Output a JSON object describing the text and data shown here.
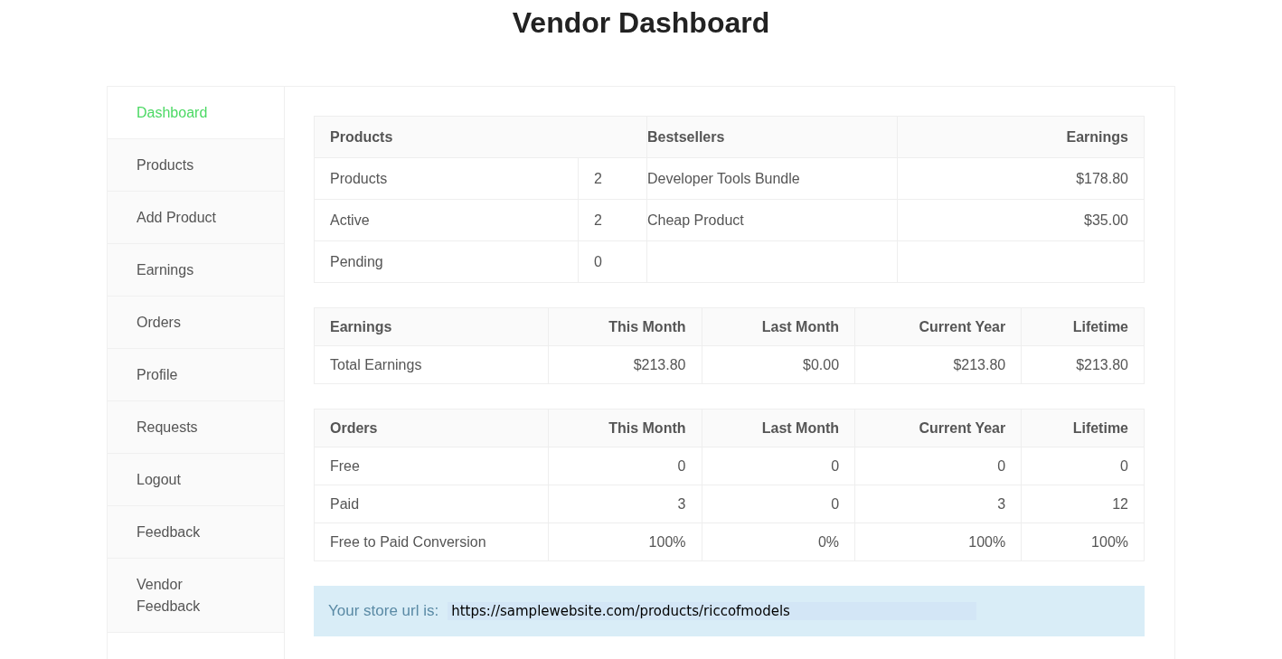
{
  "title": "Vendor Dashboard",
  "sidebar": {
    "items": [
      {
        "label": "Dashboard",
        "selected": true
      },
      {
        "label": "Products",
        "selected": false
      },
      {
        "label": "Add Product",
        "selected": false
      },
      {
        "label": "Earnings",
        "selected": false
      },
      {
        "label": "Orders",
        "selected": false
      },
      {
        "label": "Profile",
        "selected": false
      },
      {
        "label": "Requests",
        "selected": false
      },
      {
        "label": "Logout",
        "selected": false
      },
      {
        "label": "Feedback",
        "selected": false
      },
      {
        "label": "Vendor Feedback",
        "selected": false
      }
    ]
  },
  "products_table": {
    "columns": [
      {
        "label": "Products",
        "colspan": 2
      },
      {
        "label": "Bestsellers"
      },
      {
        "label": "Earnings"
      }
    ],
    "rows": [
      [
        "Products",
        "2",
        "Developer Tools Bundle",
        "$178.80"
      ],
      [
        "Active",
        "2",
        "Cheap Product",
        "$35.00"
      ],
      [
        "Pending",
        "0"
      ]
    ]
  },
  "earnings_table": {
    "columns": [
      "Earnings",
      "This Month",
      "Last Month",
      "Current Year",
      "Lifetime"
    ],
    "rows": [
      [
        "Total Earnings",
        "$213.80",
        "$0.00",
        "$213.80",
        "$213.80"
      ]
    ]
  },
  "orders_table": {
    "columns": [
      "Orders",
      "This Month",
      "Last Month",
      "Current Year",
      "Lifetime"
    ],
    "rows": [
      [
        "Free",
        "0",
        "0",
        "0",
        "0"
      ],
      [
        "Paid",
        "3",
        "0",
        "3",
        "12"
      ],
      [
        "Free to Paid Conversion",
        "100%",
        "0%",
        "100%",
        "100%"
      ]
    ]
  },
  "store_url": {
    "label": "Your store url is:",
    "value": "https://samplewebsite.com/products/riccofmodels"
  }
}
